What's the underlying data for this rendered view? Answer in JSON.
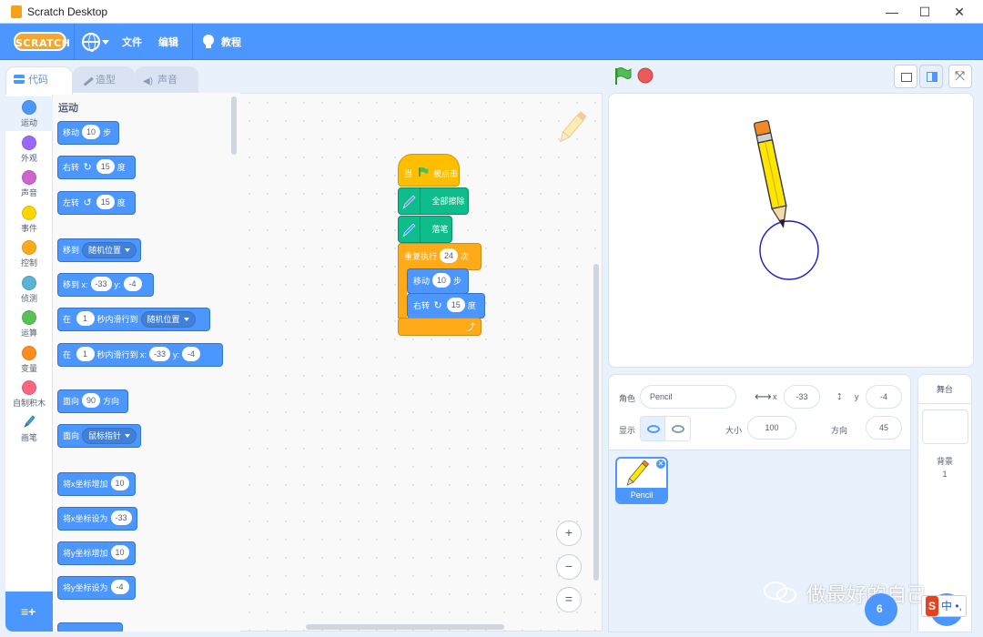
{
  "window": {
    "title": "Scratch Desktop",
    "minimize": "—",
    "maximize": "☐",
    "close": "✕"
  },
  "menubar": {
    "logo": "SCRATCH",
    "file": "文件",
    "edit": "编辑",
    "tutorials": "教程",
    "accent": "#4c97ff"
  },
  "tabs": [
    {
      "label": "代码"
    },
    {
      "label": "造型"
    },
    {
      "label": "声音"
    }
  ],
  "categories": [
    {
      "label": "运动",
      "color": "#4c97ff"
    },
    {
      "label": "外观",
      "color": "#9966ff"
    },
    {
      "label": "声音",
      "color": "#cf63cf"
    },
    {
      "label": "事件",
      "color": "#ffd500"
    },
    {
      "label": "控制",
      "color": "#ffab19"
    },
    {
      "label": "侦测",
      "color": "#5cb1d6"
    },
    {
      "label": "运算",
      "color": "#59c059"
    },
    {
      "label": "变量",
      "color": "#ff8c1a"
    },
    {
      "label": "自制积木",
      "color": "#ff6680"
    },
    {
      "label": "画笔",
      "color": "#0fbd8c"
    }
  ],
  "palette": {
    "title": "运动",
    "move": {
      "a": "移动",
      "v": "10",
      "b": "步"
    },
    "turn_right": {
      "a": "右转",
      "v": "15",
      "b": "度"
    },
    "turn_left": {
      "a": "左转",
      "v": "15",
      "b": "度"
    },
    "goto": {
      "a": "移到",
      "d": "随机位置"
    },
    "goto_xy": {
      "a": "移到 x:",
      "x": "-33",
      "b": "y:",
      "y": "-4"
    },
    "glide": {
      "a": "在",
      "v": "1",
      "b": "秒内滑行到",
      "d": "随机位置"
    },
    "glide_xy": {
      "a": "在",
      "v": "1",
      "b": "秒内滑行到 x:",
      "x": "-33",
      "c": "y:",
      "y": "-4"
    },
    "point_dir": {
      "a": "面向",
      "v": "90",
      "b": "方向"
    },
    "point_to": {
      "a": "面向",
      "d": "鼠标指针"
    },
    "change_x": {
      "a": "将x坐标增加",
      "v": "10"
    },
    "set_x": {
      "a": "将x坐标设为",
      "v": "-33"
    },
    "change_y": {
      "a": "将y坐标增加",
      "v": "10"
    },
    "set_y": {
      "a": "将y坐标设为",
      "v": "-4"
    }
  },
  "script": {
    "hat": {
      "a": "当",
      "b": "被点击"
    },
    "erase": "全部擦除",
    "pendown": "落笔",
    "repeat": {
      "a": "重复执行",
      "v": "24",
      "b": "次"
    },
    "move": {
      "a": "移动",
      "v": "10",
      "b": "步"
    },
    "turn": {
      "a": "右转",
      "v": "15",
      "b": "度"
    }
  },
  "sprite": {
    "label_sprite": "角色",
    "name": "Pencil",
    "x_label": "x",
    "x": "-33",
    "y_label": "y",
    "y": "-4",
    "show_label": "显示",
    "size_label": "大小",
    "size": "100",
    "dir_label": "方向",
    "direction": "45",
    "thumb_name": "Pencil"
  },
  "stage_panel": {
    "title": "舞台",
    "backdrops_label": "背景",
    "backdrops_count": "1"
  },
  "overlay": {
    "watermark": "做最好的自己",
    "ime_s": "S",
    "ime_text": "中 •,",
    "fab_left": "6"
  },
  "zoom": {
    "in": "+",
    "out": "−",
    "reset": "="
  }
}
